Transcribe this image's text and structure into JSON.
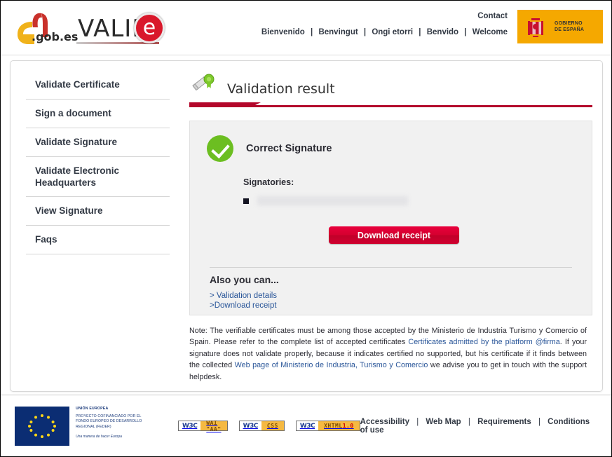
{
  "header": {
    "brand_gobes": ".gob.es",
    "brand_valide": "VALID",
    "brand_valide_e": "e",
    "contact": "Contact",
    "languages": [
      "Bienvenido",
      "Benvingut",
      "Ongi etorri",
      "Benvido",
      "Welcome"
    ],
    "gov_badge_line1": "GOBIERNO",
    "gov_badge_line2": "DE ESPAÑA"
  },
  "sidebar": {
    "items": [
      {
        "label": "Validate Certificate"
      },
      {
        "label": "Sign a document"
      },
      {
        "label": "Validate Signature"
      },
      {
        "label": "Validate Electronic Headquarters"
      },
      {
        "label": "View Signature"
      },
      {
        "label": "Faqs"
      }
    ]
  },
  "main": {
    "title": "Validation result",
    "result": {
      "status_text": "Correct Signature",
      "signatories_label": "Signatories:",
      "signatories": [
        "redacted signatory name"
      ],
      "download_button": "Download receipt"
    },
    "also": {
      "title": "Also you can...",
      "links": [
        "> Validation details",
        ">Download receipt"
      ]
    },
    "note": {
      "part1": "Note: The verifiable certificates must be among those accepted by the Ministerio de Industria Turismo y Comercio of Spain. Please refer to the complete list of accepted certificates ",
      "link1": "Certificates admitted by the platform @firma",
      "part2": ". If your signature does not validate properly, because it indicates certified no supported, but his certificate if it finds between the collected ",
      "link2": "Web page of Ministerio de Industria, Turismo y Comercio",
      "part3": " we advise you to get in touch with the support helpdesk."
    }
  },
  "footer": {
    "eu": {
      "line1": "UNIÓN EUROPEA",
      "line2": "PROYECTO COFINANCIADO POR EL FONDO EUROPEO DE DESARROLLO REGIONAL (FEDER)",
      "line3": "Una manera de hacer Europa"
    },
    "badges": [
      {
        "mark": "W3C",
        "label": "WAI \"AA\"",
        "highlight": ""
      },
      {
        "mark": "W3C",
        "label": "CSS",
        "highlight": ""
      },
      {
        "mark": "W3C",
        "label": "XHTML ",
        "highlight": "1.0"
      }
    ],
    "links": [
      "Accessibility",
      "Web Map",
      "Requirements",
      "Conditions of use"
    ]
  },
  "colors": {
    "accent_red": "#b3072b",
    "button_red": "#d50030",
    "success_green": "#6cbe21",
    "link_blue": "#2a5699",
    "gov_yellow": "#f5a800"
  }
}
